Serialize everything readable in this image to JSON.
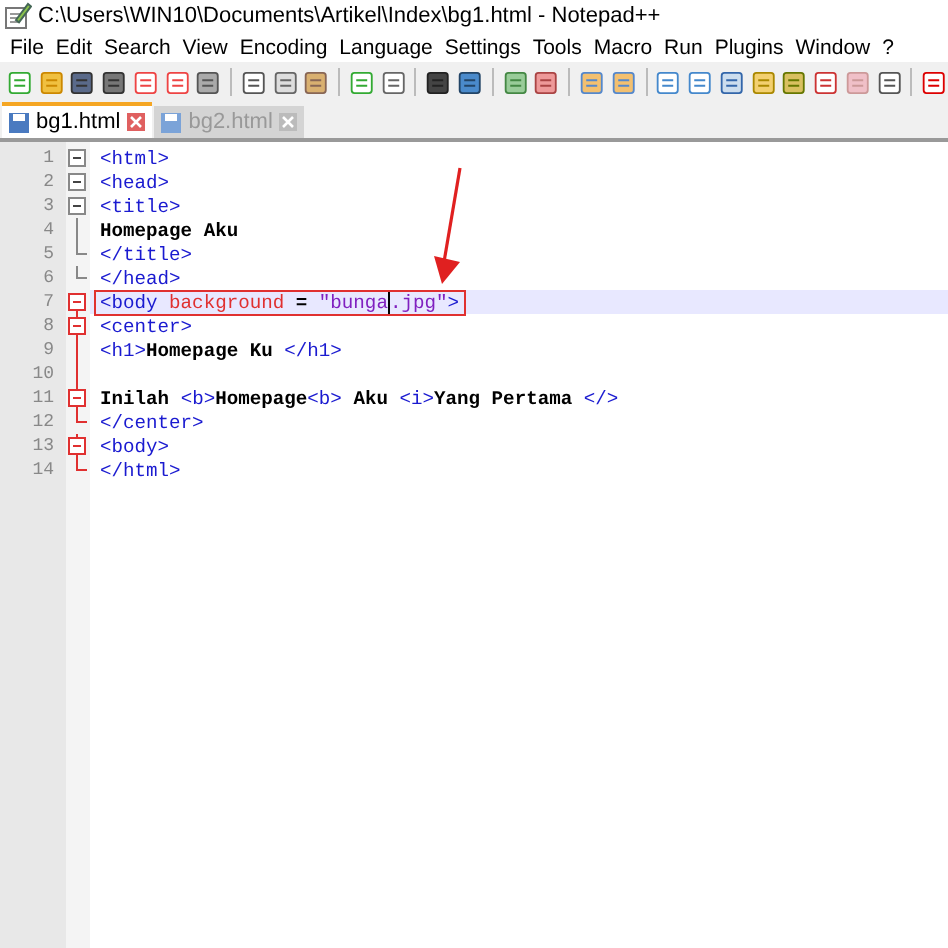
{
  "window": {
    "title": "C:\\Users\\WIN10\\Documents\\Artikel\\Index\\bg1.html - Notepad++"
  },
  "menu": [
    "File",
    "Edit",
    "Search",
    "View",
    "Encoding",
    "Language",
    "Settings",
    "Tools",
    "Macro",
    "Run",
    "Plugins",
    "Window",
    "?"
  ],
  "tabs": [
    {
      "label": "bg1.html",
      "selected": true
    },
    {
      "label": "bg2.html",
      "selected": false
    }
  ],
  "lines": [
    {
      "number": "1",
      "kind": "fold-start",
      "fold_active": false,
      "current": false,
      "boxed": false,
      "segments": [
        {
          "kind": "tag",
          "text": "<html>"
        }
      ]
    },
    {
      "number": "2",
      "kind": "fold-start",
      "fold_active": false,
      "current": false,
      "boxed": false,
      "segments": [
        {
          "kind": "tag",
          "text": "<head>"
        }
      ]
    },
    {
      "number": "3",
      "kind": "fold-start",
      "fold_active": false,
      "current": false,
      "boxed": false,
      "segments": [
        {
          "kind": "tag",
          "text": "<title>"
        }
      ]
    },
    {
      "number": "4",
      "kind": "fold-body",
      "fold_active": false,
      "current": false,
      "boxed": false,
      "segments": [
        {
          "kind": "text",
          "text": "Homepage Aku"
        }
      ]
    },
    {
      "number": "5",
      "kind": "fold-end",
      "fold_active": false,
      "current": false,
      "boxed": false,
      "segments": [
        {
          "kind": "tag",
          "text": "</title>"
        }
      ]
    },
    {
      "number": "6",
      "kind": "fold-end",
      "fold_active": false,
      "current": false,
      "boxed": false,
      "segments": [
        {
          "kind": "tag",
          "text": "</head>"
        }
      ]
    },
    {
      "number": "7",
      "kind": "fold-start",
      "fold_active": true,
      "current": true,
      "boxed": true,
      "segments": [
        {
          "kind": "tag",
          "text": "<body "
        },
        {
          "kind": "attr",
          "text": "background"
        },
        {
          "kind": "text",
          "text": " = "
        },
        {
          "kind": "value",
          "text": "\"bunga"
        },
        {
          "kind": "caret"
        },
        {
          "kind": "value",
          "text": ".jpg\""
        },
        {
          "kind": "tag",
          "text": ">"
        }
      ]
    },
    {
      "number": "8",
      "kind": "fold-start",
      "fold_active": true,
      "current": false,
      "boxed": false,
      "segments": [
        {
          "kind": "tag",
          "text": "<center>"
        }
      ]
    },
    {
      "number": "9",
      "kind": "fold-body",
      "fold_active": true,
      "current": false,
      "boxed": false,
      "segments": [
        {
          "kind": "tag",
          "text": "<h1>"
        },
        {
          "kind": "text",
          "text": "Homepage Ku "
        },
        {
          "kind": "tag",
          "text": "</h1>"
        }
      ]
    },
    {
      "number": "10",
      "kind": "fold-body",
      "fold_active": true,
      "current": false,
      "boxed": false
    },
    {
      "number": "11",
      "kind": "fold-start",
      "fold_active": true,
      "current": false,
      "boxed": false,
      "segments": [
        {
          "kind": "text",
          "text": "Inilah "
        },
        {
          "kind": "tag",
          "text": "<b>"
        },
        {
          "kind": "text",
          "text": "Homepage"
        },
        {
          "kind": "tag",
          "text": "<b>"
        },
        {
          "kind": "text",
          "text": " Aku "
        },
        {
          "kind": "tag",
          "text": "<i>"
        },
        {
          "kind": "text",
          "text": "Yang Pertama "
        },
        {
          "kind": "tag",
          "text": "</>"
        }
      ]
    },
    {
      "number": "12",
      "kind": "fold-end",
      "fold_active": true,
      "current": false,
      "boxed": false,
      "segments": [
        {
          "kind": "tag",
          "text": "</center>"
        }
      ]
    },
    {
      "number": "13",
      "kind": "fold-start",
      "fold_active": true,
      "current": false,
      "boxed": false,
      "segments": [
        {
          "kind": "tag",
          "text": "<body>"
        }
      ]
    },
    {
      "number": "14",
      "kind": "fold-end",
      "fold_active": true,
      "current": false,
      "boxed": false,
      "segments": [
        {
          "kind": "tag",
          "text": "</html>"
        }
      ]
    }
  ]
}
